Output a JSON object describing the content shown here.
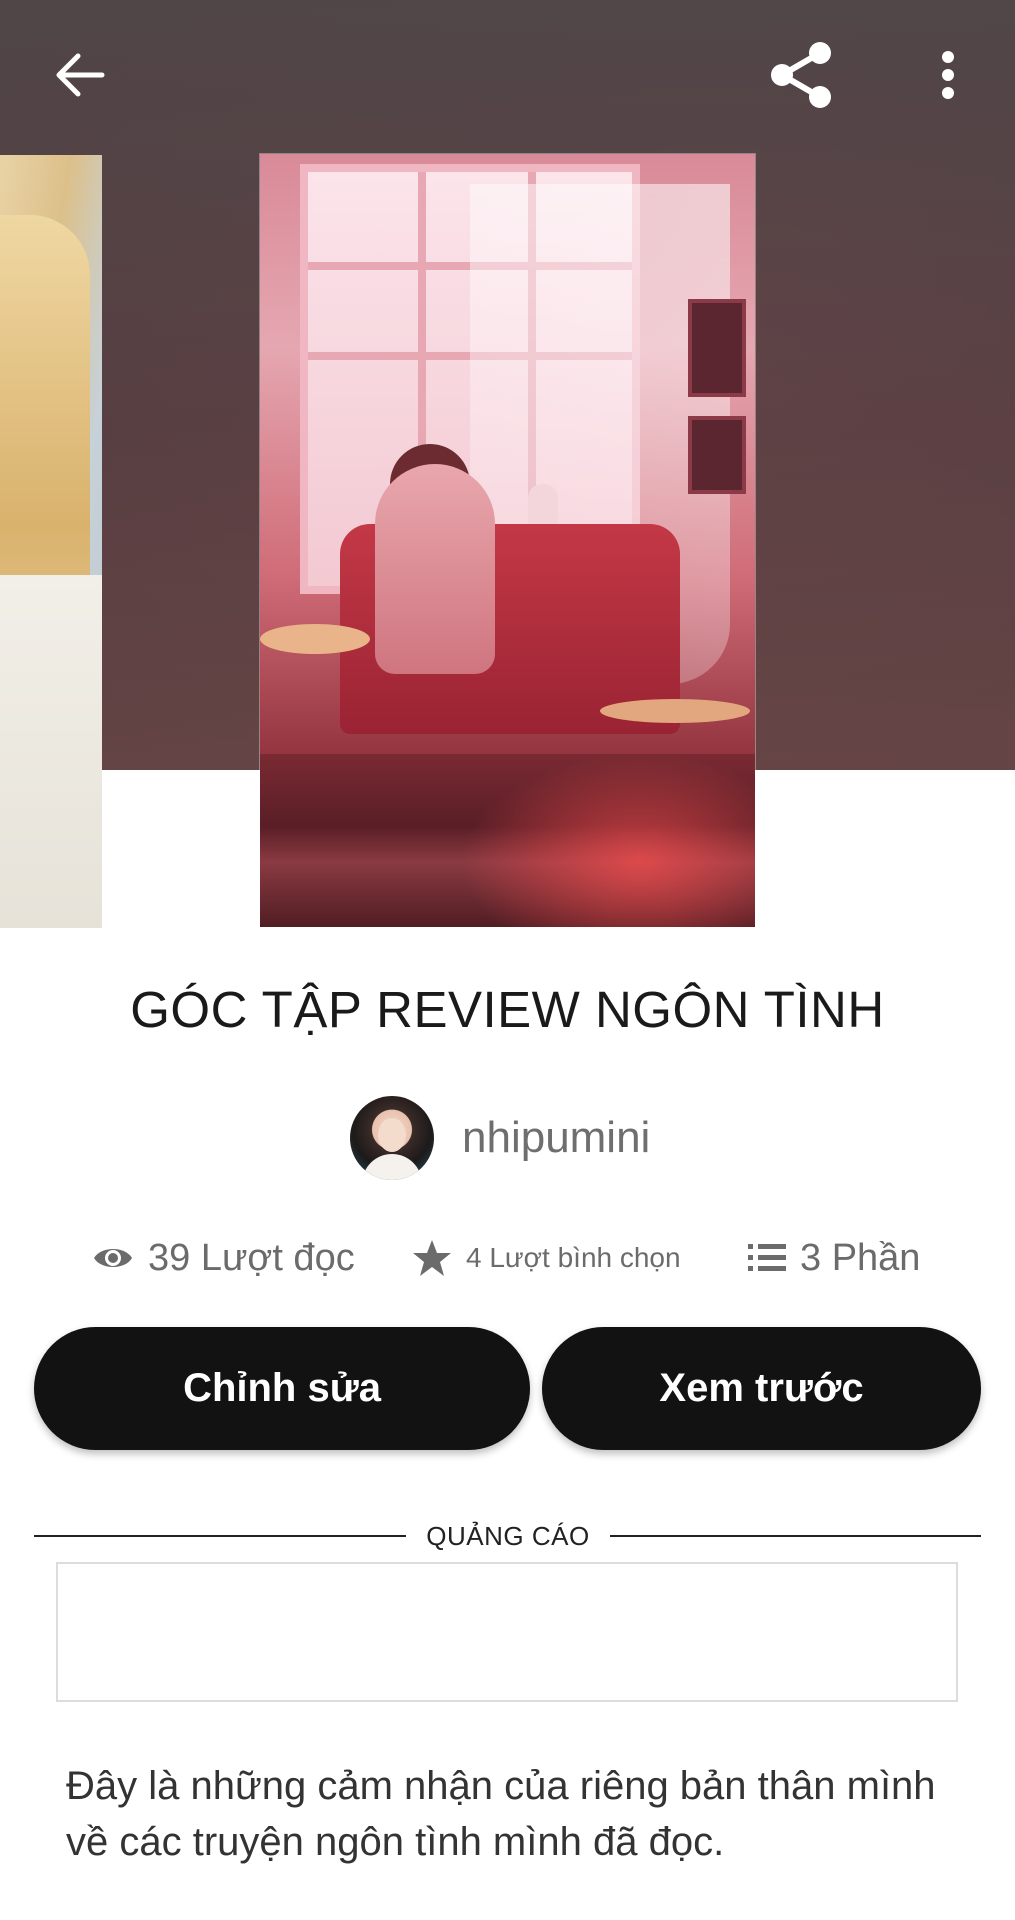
{
  "header": {
    "back_icon": "arrow-left-icon",
    "share_icon": "share-icon",
    "more_icon": "more-vertical-icon"
  },
  "story": {
    "title": "GÓC TẬP REVIEW NGÔN TÌNH",
    "author": "nhipumini",
    "description": "Đây là những cảm nhận của riêng bản thân mình về các truyện ngôn tình mình đã đọc."
  },
  "stats": {
    "reads": "39 Lượt đọc",
    "votes": "4 Lượt bình chọn",
    "parts": "3 Phần"
  },
  "actions": {
    "edit_label": "Chỉnh sửa",
    "preview_label": "Xem trước"
  },
  "ad": {
    "label": "QUẢNG CÁO"
  },
  "colors": {
    "button_bg": "#121212",
    "button_text": "#ffffff",
    "muted_text": "#6b6b6b"
  }
}
